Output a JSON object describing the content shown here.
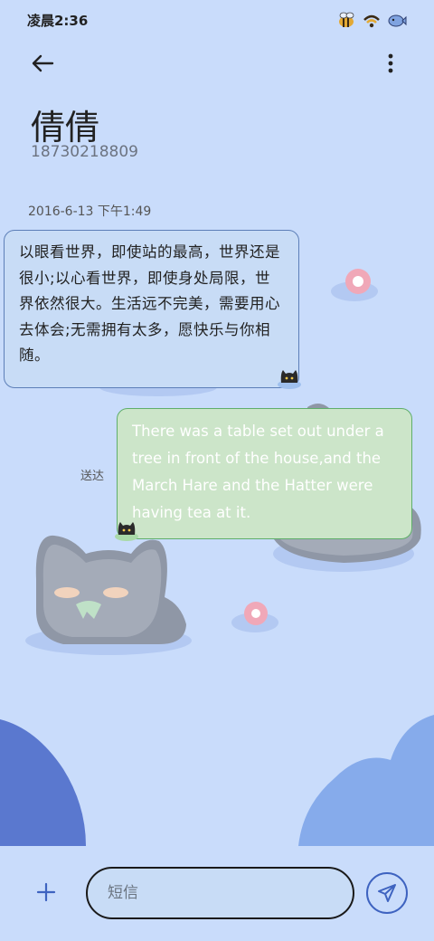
{
  "status_bar": {
    "time": "凌晨2:36",
    "icons": [
      "bee-icon",
      "wifi-icon",
      "battery-fish-icon"
    ]
  },
  "top_bar": {
    "back_icon": "arrow-left-icon",
    "more_icon": "more-vertical-icon"
  },
  "contact": {
    "name": "倩倩",
    "number": "18730218809"
  },
  "conversation": {
    "date": "2016-6-13 下午1:49",
    "incoming": {
      "text": "以眼看世界，即使站的最高，世界还是很小;以心看世界，即使身处局限，世界依然很大。生活远不完美，需要用心去体会;无需拥有太多，愿快乐与你相随。"
    },
    "outgoing": {
      "text": "There was a table set out under a tree in front of the house,and the March Hare and the Hatter were having tea at it.",
      "status": "送达"
    }
  },
  "composer": {
    "add_icon": "plus-icon",
    "placeholder": "短信",
    "value": "",
    "send_icon": "send-icon"
  },
  "colors": {
    "background": "#c9dcfb",
    "incoming_bubble": "#c8dcf6",
    "outgoing_bubble": "#cce5c9",
    "accent": "#3e63c0"
  }
}
